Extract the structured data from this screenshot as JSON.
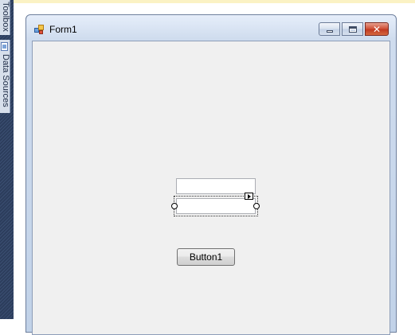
{
  "ide": {
    "side_tabs": [
      {
        "label": "Toolbox"
      },
      {
        "label": "Data Sources"
      }
    ]
  },
  "form": {
    "title": "Form1",
    "controls": {
      "textbox_1": {
        "value": ""
      },
      "textbox_2": {
        "value": ""
      },
      "button_1": {
        "label": "Button1"
      }
    }
  },
  "colors": {
    "client_background": "#f0f0f0",
    "ide_dock": "#2c3d5c",
    "close_button": "#c13a22"
  }
}
